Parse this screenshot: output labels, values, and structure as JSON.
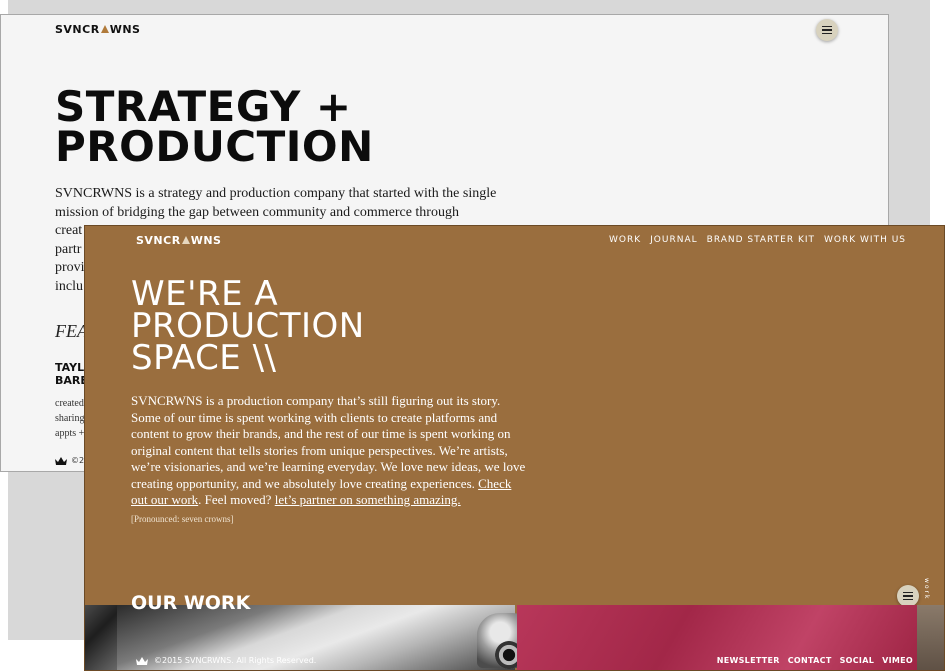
{
  "back_window": {
    "logo": {
      "prefix": "SVNCR",
      "suffix": "WNS"
    },
    "heading_line1": "STRATEGY +",
    "heading_line2": "PRODUCTION",
    "intro_lines": [
      "SVNCRWNS is a strategy and production company that started with the single",
      "mission of bridging the gap between community and commerce through",
      "creat",
      "partr",
      "provi",
      "inclu"
    ],
    "featured_partial": "FEA",
    "person_partial": [
      "TAYL",
      "BARE"
    ],
    "desc_partial": [
      "created",
      "sharing",
      "appts +"
    ],
    "footer_partial": "©20"
  },
  "front_window": {
    "logo": {
      "prefix": "SVNCR",
      "suffix": "WNS"
    },
    "nav": [
      "WORK",
      "JOURNAL",
      "BRAND STARTER KIT",
      "WORK WITH US"
    ],
    "heading_line1": "WE'RE A",
    "heading_line2": "PRODUCTION",
    "heading_line3": "SPACE \\\\",
    "intro_text": "SVNCRWNS is a production company that’s still figuring out its story. Some of our time is spent working with clients to create platforms and content to grow their brands, and the rest of our time is spent working on original content that tells stories from unique perspectives. We’re artists, we’re visionaries, and we’re learning everyday. We love new ideas, we love creating opportunity, and we absolutely love creating experiences. ",
    "link_check_work": "Check out our work",
    "mid_text": ". Feel moved? ",
    "link_partner": "let’s partner on something amazing.",
    "pronounced": "[Pronounced: seven crowns]",
    "our_work_heading": "OUR WORK",
    "side_label": "work",
    "footer_copyright": "©2015 SVNCRWNS. All Rights Reserved.",
    "footer_links": [
      "NEWSLETTER",
      "CONTACT",
      "SOCIAL",
      "VIMEO"
    ]
  },
  "colors": {
    "brown_bg": "#9a6e3e",
    "back_bg": "#f5f5f5",
    "menu_button": "#d8d2be"
  },
  "icons": [
    "menu-icon",
    "crown-icon",
    "camera-image",
    "pink-texture-image"
  ]
}
